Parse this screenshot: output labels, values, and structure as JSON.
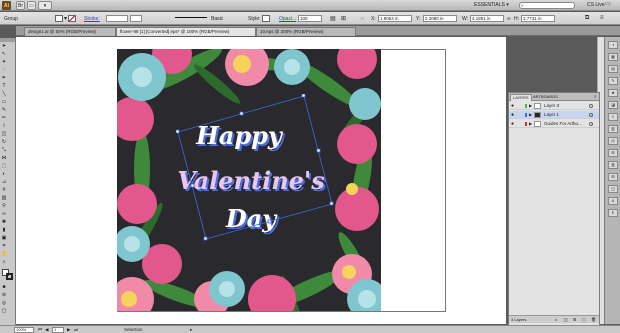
{
  "app": {
    "logo": "Ai",
    "workspace": "ESSENTIALS ▾",
    "search_placeholder": "",
    "cs_live": "CS Live"
  },
  "control_bar": {
    "object_label": "Group",
    "stroke_label": "Stroke:",
    "stroke_weight": "",
    "brush_label": "Basic",
    "style_label": "Style:",
    "opacity_link": "Opaci...",
    "opacity_value": "100",
    "x_value": "1.9054 in",
    "y_value": "2.2080 in",
    "w_value": "4.1851 in",
    "h_value": "3.7731 in"
  },
  "tabs": [
    {
      "label": "design1.ai @ 50% (RGB/Preview)",
      "active": false
    },
    {
      "label": "flower-98 [1] [Converted].eps* @ 100% (RGB/Preview)",
      "active": true
    },
    {
      "label": "10.eps @ 200% (RGB/Preview)",
      "active": false
    }
  ],
  "artwork": {
    "line1": "Happy",
    "line2": "Valentine's",
    "line3": "Day"
  },
  "layers_panel": {
    "tab_layers": "LAYERS",
    "tab_artboards": "ARTBOARDS",
    "rows": [
      {
        "name": "Layer 3",
        "color": "#4caf50",
        "selected": false
      },
      {
        "name": "Layer 1",
        "color": "#3a6bd6",
        "selected": true
      },
      {
        "name": "Guides For Artbo...",
        "color": "#c0392b",
        "selected": false
      }
    ],
    "footer": "3 Layers"
  },
  "status_bar": {
    "zoom": "100%",
    "artboard_number": "1",
    "tool_name": "Selection"
  },
  "colors": {
    "art_background": "#2a2a2e",
    "lettering": "#ffffff",
    "lettering_shadow": "#4a6ee0",
    "lettering_accent": "#e06aa0",
    "selection_blue": "#3a6bd6"
  }
}
